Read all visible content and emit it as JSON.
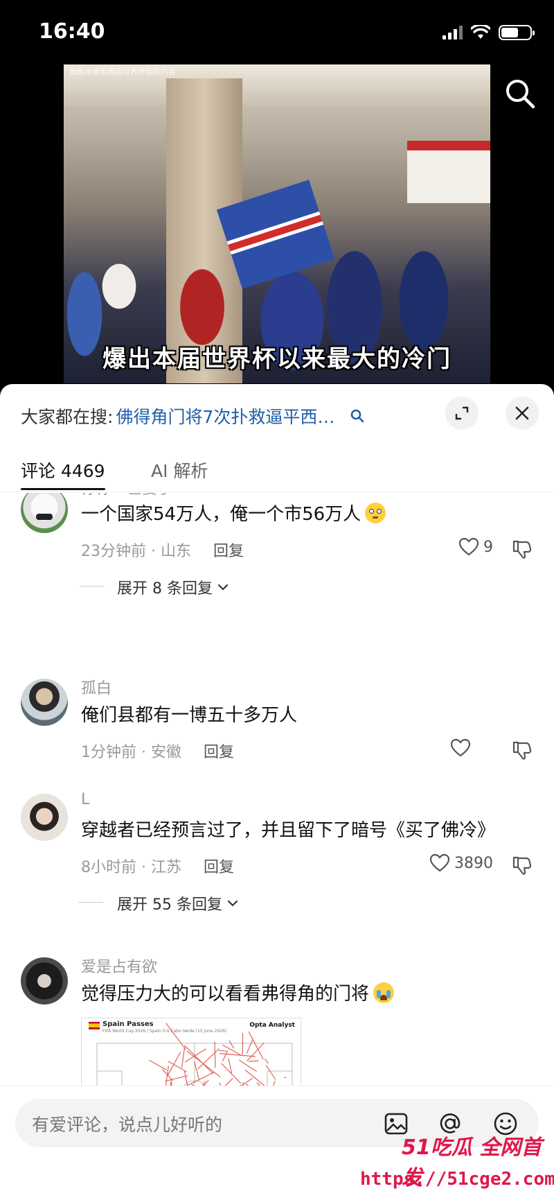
{
  "status_bar": {
    "time": "16:40"
  },
  "video": {
    "watermark": "画面未使用美国世界杯版权内容",
    "subtitle": "爆出本届世界杯以来最大的冷门"
  },
  "trend": {
    "prefix": "大家都在搜:",
    "query": "佛得角门将7次扑救逼平西…"
  },
  "tabs": [
    {
      "label": "评论 4469"
    },
    {
      "label": "AI 解析"
    }
  ],
  "comments": [
    {
      "user": "你你一已婆子",
      "text": "一个国家54万人，俺一个市56万人",
      "emoji": "flushed-face",
      "time_location": "23分钟前 · 山东",
      "reply_label": "回复",
      "likes": "9",
      "expand_label": "展开 8 条回复"
    },
    {
      "user": "孤白",
      "text": "俺们县都有一博五十多万人",
      "time_location": "1分钟前 · 安徽",
      "reply_label": "回复",
      "likes": ""
    },
    {
      "user": "L",
      "text": "穿越者已经预言过了，并且留下了暗号《买了佛冷》",
      "time_location": "8小时前 · 江苏",
      "reply_label": "回复",
      "likes": "3890",
      "expand_label": "展开 55 条回复"
    },
    {
      "user": "爱是占有欲",
      "text": "觉得压力大的可以看看弗得角的门将",
      "emoji": "crying-face",
      "image": {
        "title": "Spain Passes",
        "subtitle": "FIFA World Cup 2026 | Spain 0-0 Cabo Verde (15 June 2026)",
        "brand": "Opta Analyst"
      }
    }
  ],
  "input": {
    "placeholder": "有爱评论，说点儿好听的"
  },
  "overlay_watermark": {
    "logo": "51吃瓜 全网首发",
    "url": "https://51cge2.com"
  },
  "colors": {
    "link_blue": "#1f5fa8",
    "watermark_red": "#e0174a"
  }
}
